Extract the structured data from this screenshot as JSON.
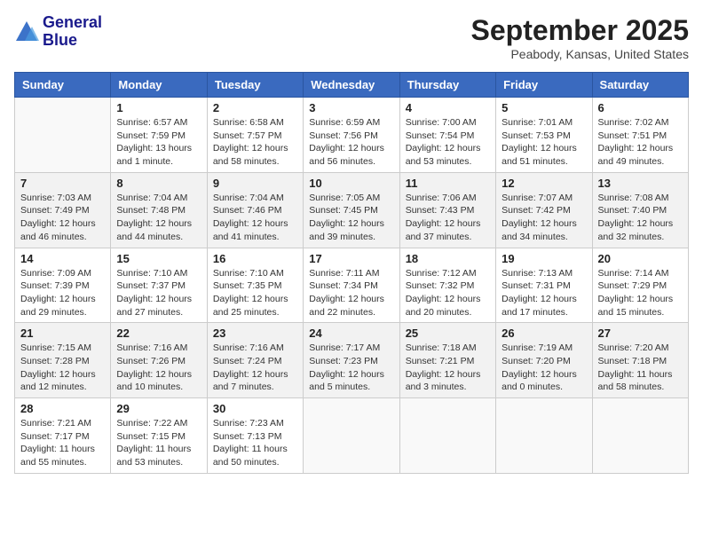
{
  "header": {
    "logo_line1": "General",
    "logo_line2": "Blue",
    "month": "September 2025",
    "location": "Peabody, Kansas, United States"
  },
  "weekdays": [
    "Sunday",
    "Monday",
    "Tuesday",
    "Wednesday",
    "Thursday",
    "Friday",
    "Saturday"
  ],
  "weeks": [
    [
      {
        "day": "",
        "sunrise": "",
        "sunset": "",
        "daylight": ""
      },
      {
        "day": "1",
        "sunrise": "Sunrise: 6:57 AM",
        "sunset": "Sunset: 7:59 PM",
        "daylight": "Daylight: 13 hours and 1 minute."
      },
      {
        "day": "2",
        "sunrise": "Sunrise: 6:58 AM",
        "sunset": "Sunset: 7:57 PM",
        "daylight": "Daylight: 12 hours and 58 minutes."
      },
      {
        "day": "3",
        "sunrise": "Sunrise: 6:59 AM",
        "sunset": "Sunset: 7:56 PM",
        "daylight": "Daylight: 12 hours and 56 minutes."
      },
      {
        "day": "4",
        "sunrise": "Sunrise: 7:00 AM",
        "sunset": "Sunset: 7:54 PM",
        "daylight": "Daylight: 12 hours and 53 minutes."
      },
      {
        "day": "5",
        "sunrise": "Sunrise: 7:01 AM",
        "sunset": "Sunset: 7:53 PM",
        "daylight": "Daylight: 12 hours and 51 minutes."
      },
      {
        "day": "6",
        "sunrise": "Sunrise: 7:02 AM",
        "sunset": "Sunset: 7:51 PM",
        "daylight": "Daylight: 12 hours and 49 minutes."
      }
    ],
    [
      {
        "day": "7",
        "sunrise": "Sunrise: 7:03 AM",
        "sunset": "Sunset: 7:49 PM",
        "daylight": "Daylight: 12 hours and 46 minutes."
      },
      {
        "day": "8",
        "sunrise": "Sunrise: 7:04 AM",
        "sunset": "Sunset: 7:48 PM",
        "daylight": "Daylight: 12 hours and 44 minutes."
      },
      {
        "day": "9",
        "sunrise": "Sunrise: 7:04 AM",
        "sunset": "Sunset: 7:46 PM",
        "daylight": "Daylight: 12 hours and 41 minutes."
      },
      {
        "day": "10",
        "sunrise": "Sunrise: 7:05 AM",
        "sunset": "Sunset: 7:45 PM",
        "daylight": "Daylight: 12 hours and 39 minutes."
      },
      {
        "day": "11",
        "sunrise": "Sunrise: 7:06 AM",
        "sunset": "Sunset: 7:43 PM",
        "daylight": "Daylight: 12 hours and 37 minutes."
      },
      {
        "day": "12",
        "sunrise": "Sunrise: 7:07 AM",
        "sunset": "Sunset: 7:42 PM",
        "daylight": "Daylight: 12 hours and 34 minutes."
      },
      {
        "day": "13",
        "sunrise": "Sunrise: 7:08 AM",
        "sunset": "Sunset: 7:40 PM",
        "daylight": "Daylight: 12 hours and 32 minutes."
      }
    ],
    [
      {
        "day": "14",
        "sunrise": "Sunrise: 7:09 AM",
        "sunset": "Sunset: 7:39 PM",
        "daylight": "Daylight: 12 hours and 29 minutes."
      },
      {
        "day": "15",
        "sunrise": "Sunrise: 7:10 AM",
        "sunset": "Sunset: 7:37 PM",
        "daylight": "Daylight: 12 hours and 27 minutes."
      },
      {
        "day": "16",
        "sunrise": "Sunrise: 7:10 AM",
        "sunset": "Sunset: 7:35 PM",
        "daylight": "Daylight: 12 hours and 25 minutes."
      },
      {
        "day": "17",
        "sunrise": "Sunrise: 7:11 AM",
        "sunset": "Sunset: 7:34 PM",
        "daylight": "Daylight: 12 hours and 22 minutes."
      },
      {
        "day": "18",
        "sunrise": "Sunrise: 7:12 AM",
        "sunset": "Sunset: 7:32 PM",
        "daylight": "Daylight: 12 hours and 20 minutes."
      },
      {
        "day": "19",
        "sunrise": "Sunrise: 7:13 AM",
        "sunset": "Sunset: 7:31 PM",
        "daylight": "Daylight: 12 hours and 17 minutes."
      },
      {
        "day": "20",
        "sunrise": "Sunrise: 7:14 AM",
        "sunset": "Sunset: 7:29 PM",
        "daylight": "Daylight: 12 hours and 15 minutes."
      }
    ],
    [
      {
        "day": "21",
        "sunrise": "Sunrise: 7:15 AM",
        "sunset": "Sunset: 7:28 PM",
        "daylight": "Daylight: 12 hours and 12 minutes."
      },
      {
        "day": "22",
        "sunrise": "Sunrise: 7:16 AM",
        "sunset": "Sunset: 7:26 PM",
        "daylight": "Daylight: 12 hours and 10 minutes."
      },
      {
        "day": "23",
        "sunrise": "Sunrise: 7:16 AM",
        "sunset": "Sunset: 7:24 PM",
        "daylight": "Daylight: 12 hours and 7 minutes."
      },
      {
        "day": "24",
        "sunrise": "Sunrise: 7:17 AM",
        "sunset": "Sunset: 7:23 PM",
        "daylight": "Daylight: 12 hours and 5 minutes."
      },
      {
        "day": "25",
        "sunrise": "Sunrise: 7:18 AM",
        "sunset": "Sunset: 7:21 PM",
        "daylight": "Daylight: 12 hours and 3 minutes."
      },
      {
        "day": "26",
        "sunrise": "Sunrise: 7:19 AM",
        "sunset": "Sunset: 7:20 PM",
        "daylight": "Daylight: 12 hours and 0 minutes."
      },
      {
        "day": "27",
        "sunrise": "Sunrise: 7:20 AM",
        "sunset": "Sunset: 7:18 PM",
        "daylight": "Daylight: 11 hours and 58 minutes."
      }
    ],
    [
      {
        "day": "28",
        "sunrise": "Sunrise: 7:21 AM",
        "sunset": "Sunset: 7:17 PM",
        "daylight": "Daylight: 11 hours and 55 minutes."
      },
      {
        "day": "29",
        "sunrise": "Sunrise: 7:22 AM",
        "sunset": "Sunset: 7:15 PM",
        "daylight": "Daylight: 11 hours and 53 minutes."
      },
      {
        "day": "30",
        "sunrise": "Sunrise: 7:23 AM",
        "sunset": "Sunset: 7:13 PM",
        "daylight": "Daylight: 11 hours and 50 minutes."
      },
      {
        "day": "",
        "sunrise": "",
        "sunset": "",
        "daylight": ""
      },
      {
        "day": "",
        "sunrise": "",
        "sunset": "",
        "daylight": ""
      },
      {
        "day": "",
        "sunrise": "",
        "sunset": "",
        "daylight": ""
      },
      {
        "day": "",
        "sunrise": "",
        "sunset": "",
        "daylight": ""
      }
    ]
  ]
}
